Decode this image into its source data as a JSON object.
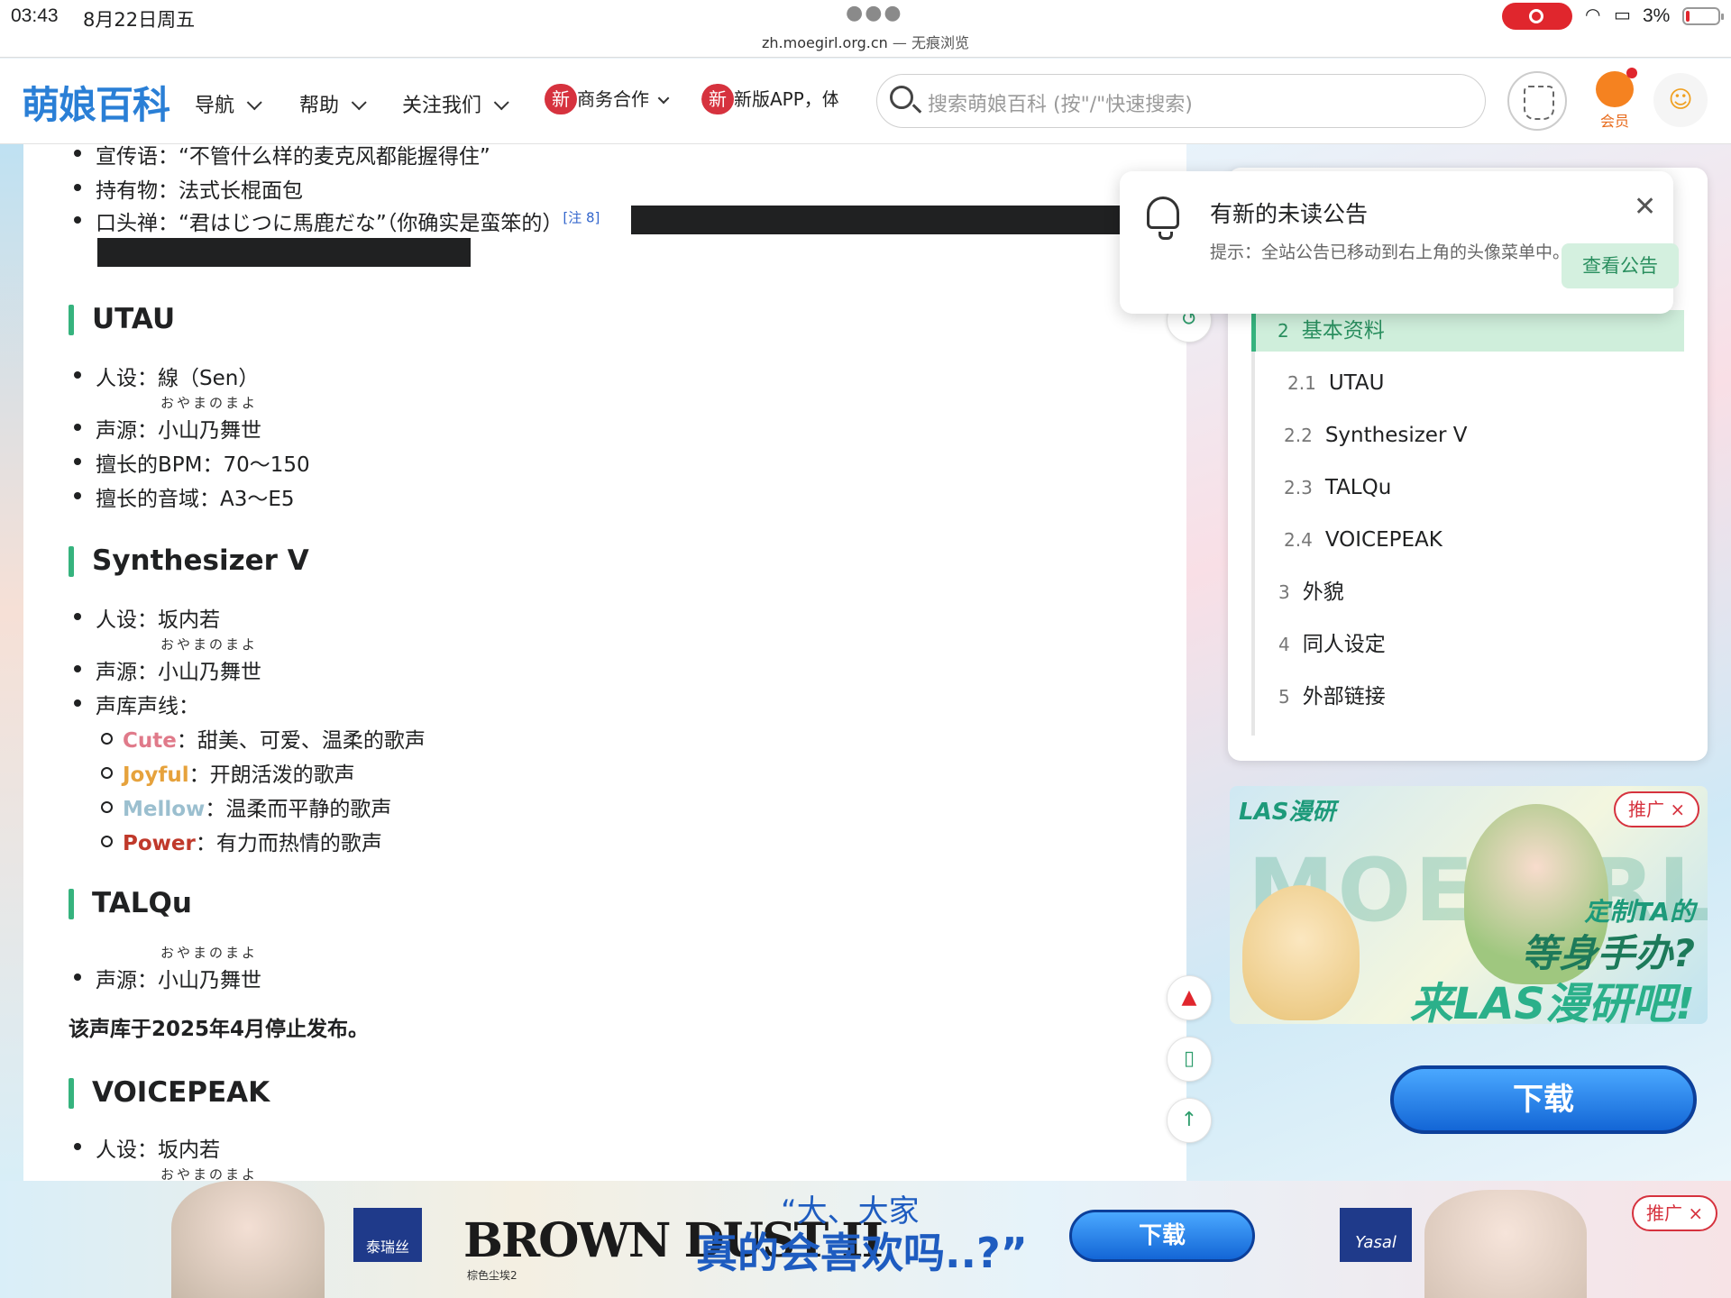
{
  "status": {
    "time": "03:43",
    "date": "8月22日周五",
    "battery": "3%"
  },
  "url": {
    "host": "zh.moegirl.org.cn",
    "mode": "— 无痕浏览"
  },
  "header": {
    "logo": "萌娘百科",
    "nav": [
      "导航",
      "帮助",
      "关注我们"
    ],
    "new_badge": "新",
    "promo1": "商务合作",
    "promo2": "新版APP，体",
    "search_placeholder": "搜索萌娘百科 (按\"/\"快速搜索)",
    "vip_label": "会员"
  },
  "article": {
    "top_items": [
      "宣传语：“不管什么样的麦克风都能握得住”",
      "持有物：法式长棍面包",
      "口头禅：“君はじつに馬鹿だな”（你确实是蛮笨的）"
    ],
    "note_ref": "[注 8]",
    "ruby": "おやまのまよ",
    "utau": {
      "heading": "UTAU",
      "items": [
        "人设：線（Sen）",
        "声源：小山乃舞世",
        "擅长的BPM：70～150",
        "擅长的音域：A3～E5"
      ]
    },
    "synth": {
      "heading": "Synthesizer V",
      "items": [
        "人设：坂内若",
        "声源：小山乃舞世",
        "声库声线："
      ],
      "voices": [
        {
          "name": "Cute",
          "desc": "：甜美、可爱、温柔的歌声",
          "color": "#e07a8a"
        },
        {
          "name": "Joyful",
          "desc": "：开朗活泼的歌声",
          "color": "#e6a23c"
        },
        {
          "name": "Mellow",
          "desc": "：温柔而平静的歌声",
          "color": "#9bbfcf"
        },
        {
          "name": "Power",
          "desc": "：有力而热情的歌声",
          "color": "#c0392b"
        }
      ]
    },
    "talqu": {
      "heading": "TALQu",
      "items": [
        "声源：小山乃舞世"
      ],
      "note": "该声库于2025年4月停止发布。"
    },
    "voicepeak": {
      "heading": "VOICEPEAK",
      "items": [
        "人设：坂内若"
      ]
    }
  },
  "toc": {
    "items": [
      {
        "num": "2",
        "label": "基本资料",
        "active": true
      },
      {
        "num": "2.1",
        "label": "UTAU"
      },
      {
        "num": "2.2",
        "label": "Synthesizer V"
      },
      {
        "num": "2.3",
        "label": "TALQu"
      },
      {
        "num": "2.4",
        "label": "VOICEPEAK"
      },
      {
        "num": "3",
        "label": "外貌"
      },
      {
        "num": "4",
        "label": "同人设定"
      },
      {
        "num": "5",
        "label": "外部链接"
      }
    ]
  },
  "notice": {
    "title": "有新的未读公告",
    "desc": "提示：全站公告已移动到右上角的头像菜单中。",
    "button": "查看公告"
  },
  "ads": {
    "promo_label": "推广 ×",
    "side": {
      "brand": "LAS漫研",
      "bigword": "MOEGIRL",
      "line1": "定制TA的",
      "line2": "等身手办?",
      "line3": "来LAS漫研吧!"
    },
    "download": "下载",
    "bottom": {
      "tag1": "泰瑞丝",
      "game": "BROWN DUST II",
      "game_sub": "棕色尘埃2",
      "quote_small": "“大、大家",
      "quote_big": "真的会喜欢吗..?”",
      "tag2": "Yasal"
    }
  }
}
